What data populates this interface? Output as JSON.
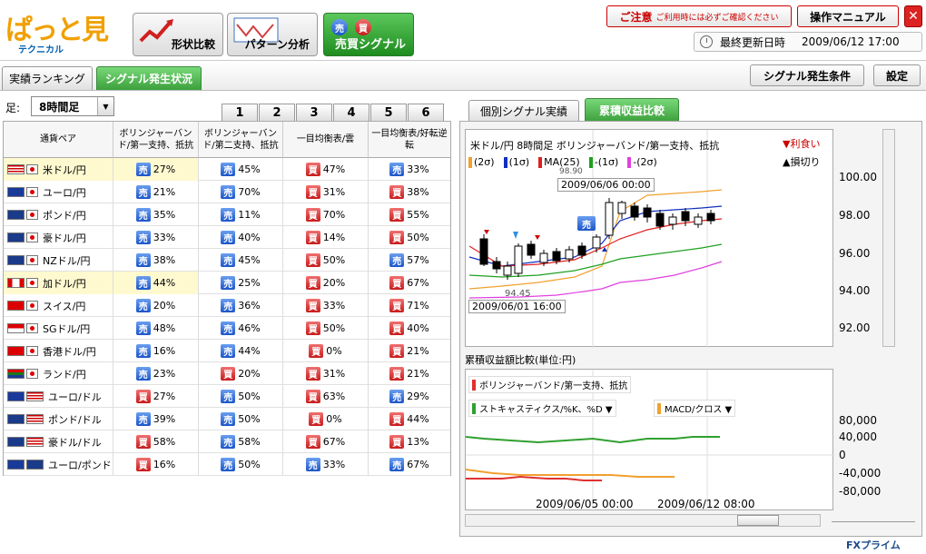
{
  "logo": {
    "top": "ぱっと見",
    "bottom": "テクニカル"
  },
  "nav": [
    {
      "label": "形状比較"
    },
    {
      "label": "パターン分析"
    },
    {
      "label": "売買シグナル",
      "badge1": "売",
      "badge2": "買"
    }
  ],
  "caution": {
    "label": "ご注意",
    "note": "ご利用時には必ずご確認ください"
  },
  "manual": "操作マニュアル",
  "close": "✕",
  "updated": {
    "label": "最終更新日時",
    "value": "2009/06/12 17:00"
  },
  "subtabs": [
    "実績ランキング",
    "シグナル発生状況"
  ],
  "right_buttons": [
    "シグナル発生条件",
    "設定"
  ],
  "ashi": {
    "label": "足:",
    "value": "8時間足"
  },
  "num_tabs": [
    "1",
    "2",
    "3",
    "4",
    "5",
    "6"
  ],
  "headers": [
    "通貨ペア",
    "ボリンジャーバンド/第一支持、抵抗",
    "ボリンジャーバンド/第二支持、抵抗",
    "一目均衡表/雲",
    "一目均衡表/好転逆転"
  ],
  "rows": [
    {
      "pair": "米ドル/円",
      "s": [
        [
          "売",
          "27%"
        ],
        [
          "売",
          "45%"
        ],
        [
          "買",
          "47%"
        ],
        [
          "売",
          "33%"
        ]
      ]
    },
    {
      "pair": "ユーロ/円",
      "s": [
        [
          "売",
          "21%"
        ],
        [
          "売",
          "70%"
        ],
        [
          "買",
          "31%"
        ],
        [
          "買",
          "38%"
        ]
      ]
    },
    {
      "pair": "ポンド/円",
      "s": [
        [
          "売",
          "35%"
        ],
        [
          "売",
          "11%"
        ],
        [
          "買",
          "70%"
        ],
        [
          "買",
          "55%"
        ]
      ]
    },
    {
      "pair": "豪ドル/円",
      "s": [
        [
          "売",
          "33%"
        ],
        [
          "売",
          "40%"
        ],
        [
          "買",
          "14%"
        ],
        [
          "買",
          "50%"
        ]
      ]
    },
    {
      "pair": "NZドル/円",
      "s": [
        [
          "売",
          "38%"
        ],
        [
          "売",
          "45%"
        ],
        [
          "買",
          "50%"
        ],
        [
          "売",
          "57%"
        ]
      ]
    },
    {
      "pair": "加ドル/円",
      "s": [
        [
          "売",
          "44%"
        ],
        [
          "売",
          "25%"
        ],
        [
          "買",
          "20%"
        ],
        [
          "買",
          "67%"
        ]
      ]
    },
    {
      "pair": "スイス/円",
      "s": [
        [
          "売",
          "20%"
        ],
        [
          "売",
          "36%"
        ],
        [
          "買",
          "33%"
        ],
        [
          "買",
          "71%"
        ]
      ]
    },
    {
      "pair": "SGドル/円",
      "s": [
        [
          "売",
          "48%"
        ],
        [
          "売",
          "46%"
        ],
        [
          "買",
          "50%"
        ],
        [
          "買",
          "40%"
        ]
      ]
    },
    {
      "pair": "香港ドル/円",
      "s": [
        [
          "売",
          "16%"
        ],
        [
          "売",
          "44%"
        ],
        [
          "買",
          "0%"
        ],
        [
          "買",
          "21%"
        ]
      ]
    },
    {
      "pair": "ランド/円",
      "s": [
        [
          "売",
          "23%"
        ],
        [
          "買",
          "20%"
        ],
        [
          "買",
          "31%"
        ],
        [
          "買",
          "21%"
        ]
      ]
    },
    {
      "pair": "ユーロ/ドル",
      "s": [
        [
          "買",
          "27%"
        ],
        [
          "売",
          "50%"
        ],
        [
          "買",
          "63%"
        ],
        [
          "売",
          "29%"
        ]
      ]
    },
    {
      "pair": "ポンド/ドル",
      "s": [
        [
          "売",
          "39%"
        ],
        [
          "売",
          "50%"
        ],
        [
          "買",
          "0%"
        ],
        [
          "買",
          "44%"
        ]
      ]
    },
    {
      "pair": "豪ドル/ドル",
      "s": [
        [
          "買",
          "58%"
        ],
        [
          "売",
          "58%"
        ],
        [
          "買",
          "67%"
        ],
        [
          "買",
          "13%"
        ]
      ]
    },
    {
      "pair": "ユーロ/ポンド",
      "s": [
        [
          "買",
          "16%"
        ],
        [
          "売",
          "50%"
        ],
        [
          "売",
          "33%"
        ],
        [
          "売",
          "67%"
        ]
      ]
    }
  ],
  "right_tabs": [
    "個別シグナル実績",
    "累積収益比較"
  ],
  "chart1": {
    "title": "米ドル/円 8時間足 ボリンジャーバンド/第一支持、抵抗",
    "legend": [
      {
        "label": "(2σ)",
        "color": "#f0a030"
      },
      {
        "label": "(1σ)",
        "color": "#1030c0"
      },
      {
        "label": "MA(25)",
        "color": "#e02020"
      },
      {
        "label": "-(1σ)",
        "color": "#20a020"
      },
      {
        "label": "-(2σ)",
        "color": "#e040e0"
      }
    ],
    "take_profit": "▼利食い",
    "stop_loss": "▲損切り",
    "yticks": [
      "100.00",
      "98.00",
      "96.00",
      "94.00",
      "92.00"
    ],
    "annot_high_val": "98.90",
    "annot_high_date": "2009/06/06 00:00",
    "annot_low_val": "94.45",
    "annot_low_date": "2009/06/01 16:00",
    "sell_marker": "売"
  },
  "chart2": {
    "title": "累積収益額比較(単位:円)",
    "legend": [
      {
        "label": "ボリンジャーバンド/第一支持、抵抗",
        "color": "#e03030"
      },
      {
        "label": "ストキャスティクス/%K、%D ▼",
        "color": "#30a030"
      },
      {
        "label": "MACD/クロス ▼",
        "color": "#f0a030"
      }
    ],
    "yticks": [
      "80,000",
      "40,000",
      "0",
      "-40,000",
      "-80,000"
    ],
    "xticks": [
      "2009/06/05 00:00",
      "2009/06/12 08:00"
    ]
  },
  "footer": "FXプライム"
}
